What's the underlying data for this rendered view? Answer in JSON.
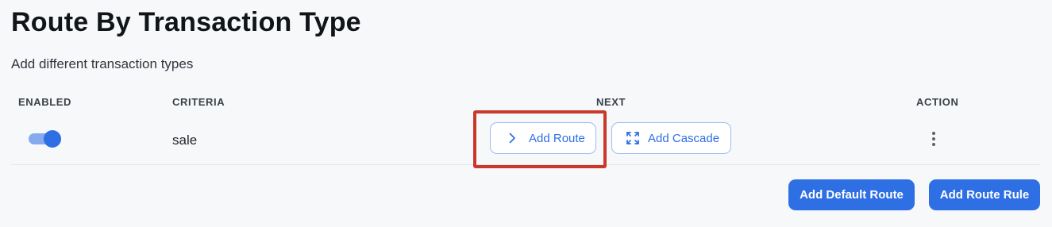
{
  "header": {
    "title": "Route By Transaction Type",
    "subtitle": "Add different transaction types"
  },
  "table": {
    "columns": [
      "ENABLED",
      "CRITERIA",
      "NEXT",
      "ACTION"
    ],
    "rows": [
      {
        "enabled": true,
        "criteria": "sale",
        "next": {
          "add_route_label": "Add Route",
          "add_cascade_label": "Add Cascade"
        }
      }
    ]
  },
  "footer": {
    "add_default_route_label": "Add Default Route",
    "add_route_rule_label": "Add Route Rule"
  },
  "icons": {
    "add_route": "chevron-right-icon",
    "add_cascade": "expand-icon",
    "action": "more-vertical-icon"
  },
  "colors": {
    "accent": "#2f6fe4",
    "toggle_track": "#86a9ef",
    "highlight": "#c9382a",
    "background": "#f7f8fa"
  }
}
